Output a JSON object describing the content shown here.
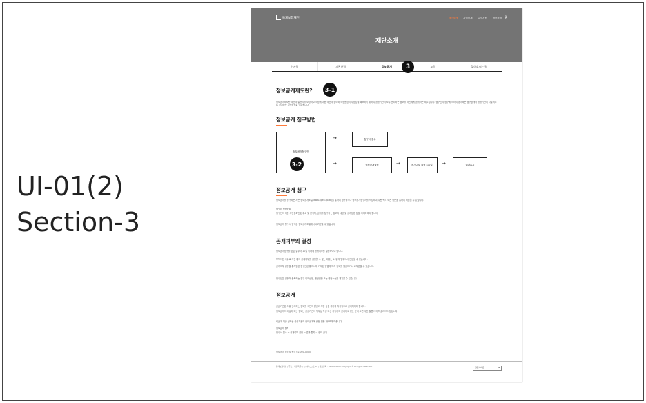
{
  "slide": {
    "label_line1": "UI-01(2)",
    "label_line2": "Section-3"
  },
  "header": {
    "logo_text": "통계보험재단",
    "nav": [
      "재단소개",
      "사업소개",
      "고객지원",
      "정보공개"
    ],
    "search_icon": "search-icon",
    "hero_title": "재단소개"
  },
  "subnav": {
    "items": [
      "인사말",
      "기관연혁",
      "정보공개",
      "조직",
      "찾아오시는 길"
    ]
  },
  "badges": {
    "section": "3",
    "what_is": "3-1",
    "method": "3-2"
  },
  "main": {
    "what_is": {
      "title": "정보공개제도란?",
      "body": "정보공개제도란 국민의 알권리를 보장하고 국정에 대한 국민의 참여와 국정운영의 투명성을 확보하기 위하여 공공기관이 보유·관리하는 정보를 국민에게 공개하는 제도입니다. 청구인의 청구에 의하여 공개하는 청구공개와 공공기관이 자발적으로 공개하는 사전공표로 구분됩니다."
    },
    "method": {
      "title": "정보공개 청구방법",
      "left_label": "정보공개청구인",
      "steps": [
        "청구서 접수",
        "정보공개결정",
        "공개여부 결정 (10일)",
        "결과통지"
      ],
      "arrow": "→"
    },
    "request": {
      "title": "정보공개 청구",
      "body1": "정보공개를 청구하는 자는 정보공개포털(www.open.go.kr)을 통하여 청구하거나 정보공개청구서를 작성하여 우편·팩스 또는 방문을 통하여 제출할 수 있습니다.",
      "label": "청구서 작성방법",
      "body2": "청구인의 이름·주민등록번호·주소 및 연락처, 공개를 청구하는 정보의 내용 및 공개방법 등을 기재하여야 합니다.",
      "body3": "정보공개 청구서 양식은 정보공개포털에서 내려받을 수 있습니다."
    },
    "decision": {
      "title": "공개여부의 결정",
      "body1": "정보공개청구를 받은 날부터 10일 이내에 공개여부를 결정하여야 합니다.",
      "body2": "부득이한 사유로 기간 내에 공개여부를 결정할 수 없는 때에는 10일의 범위에서 연장할 수 있습니다.",
      "body3": "공개여부 결정을 통지받은 청구인은 통지서에 기재된 방법에 따라 정보를 열람하거나 교부받을 수 있습니다.",
      "body4": "청구인은 결정에 불복하는 경우 이의신청, 행정심판 또는 행정소송을 제기할 수 있습니다."
    },
    "disclosure": {
      "title": "정보공개",
      "body1": "공공기관은 보유·관리하는 정보를 국민의 알권리 보장 등을 위하여 적극적으로 공개하여야 합니다.",
      "body2": "정보공개의 대상이 되는 정보는 공공기관이 직무상 작성 또는 취득하여 관리하고 있는 문서·도면·사진·필름·테이프·슬라이드 등입니다.",
      "body3": "비공개 대상 정보는 공공기관의 정보공개에 관한 법률 제9조에 따릅니다.",
      "label": "정보공개 절차",
      "body4": "청구서 접수 → 공개여부 결정 → 결과 통지 → 정보 공개",
      "contact": "정보공개 담당자 문의 02-000-0000"
    }
  },
  "footer": {
    "text": "통계보험재단 | 주소 : 서울특별시 ○○구 ○○로 00 | 대표전화 : 02-000-0000 Copyright © All rights reserved.",
    "family_site": "관련사이트"
  }
}
